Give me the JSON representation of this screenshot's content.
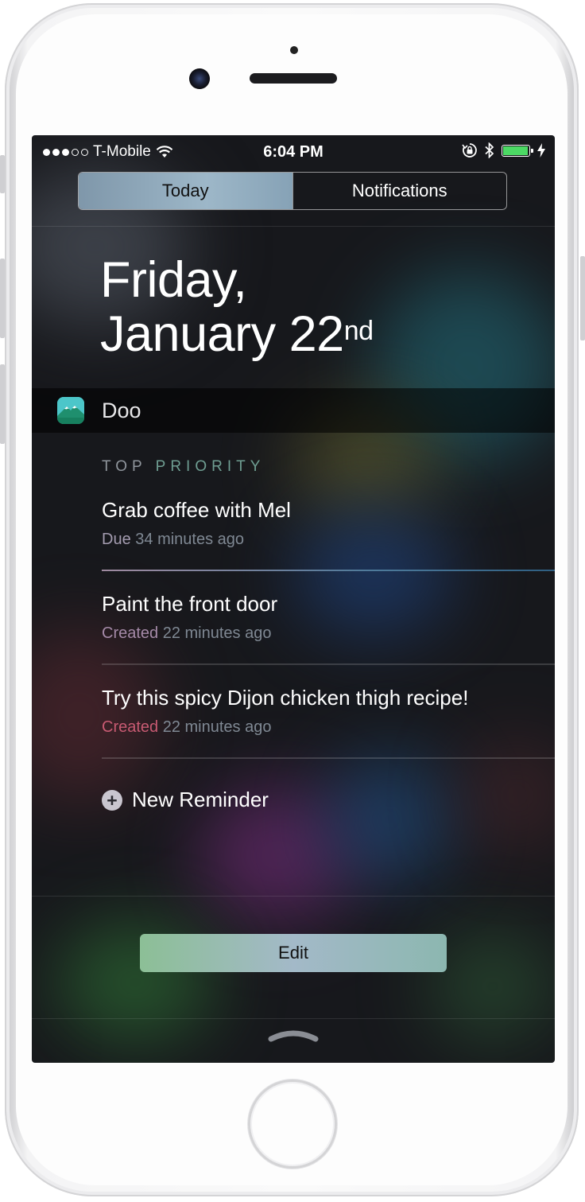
{
  "status_bar": {
    "carrier": "T-Mobile",
    "time": "6:04 PM",
    "signal_bars_filled": 3,
    "signal_bars_total": 5,
    "battery_level": 0.9,
    "icons": [
      "wifi-icon",
      "rotation-lock-icon",
      "bluetooth-icon",
      "battery-icon",
      "charging-bolt-icon"
    ]
  },
  "tabs": [
    {
      "label": "Today",
      "active": true
    },
    {
      "label": "Notifications",
      "active": false
    }
  ],
  "date": {
    "weekday": "Friday,",
    "month_day": "January 22",
    "suffix": "nd"
  },
  "widget": {
    "app_name": "Doo",
    "section_label_part1": "TOP",
    "section_label_part2": "PRIORITY",
    "reminders": [
      {
        "title": "Grab coffee with Mel",
        "status": "Due",
        "time": "34 minutes ago",
        "status_color": "#a49cb0"
      },
      {
        "title": "Paint the front door",
        "status": "Created",
        "time": "22 minutes ago",
        "status_color": "#a58aa8"
      },
      {
        "title": "Try this spicy Dijon chicken thigh recipe!",
        "status": "Created",
        "time": "22 minutes ago",
        "status_color": "#c75a72"
      }
    ],
    "new_reminder_label": "New Reminder"
  },
  "edit_label": "Edit",
  "colors": {
    "battery": "#4cd964",
    "segment_active": "#9db7c8",
    "edit_button": "#a3b9c8"
  }
}
